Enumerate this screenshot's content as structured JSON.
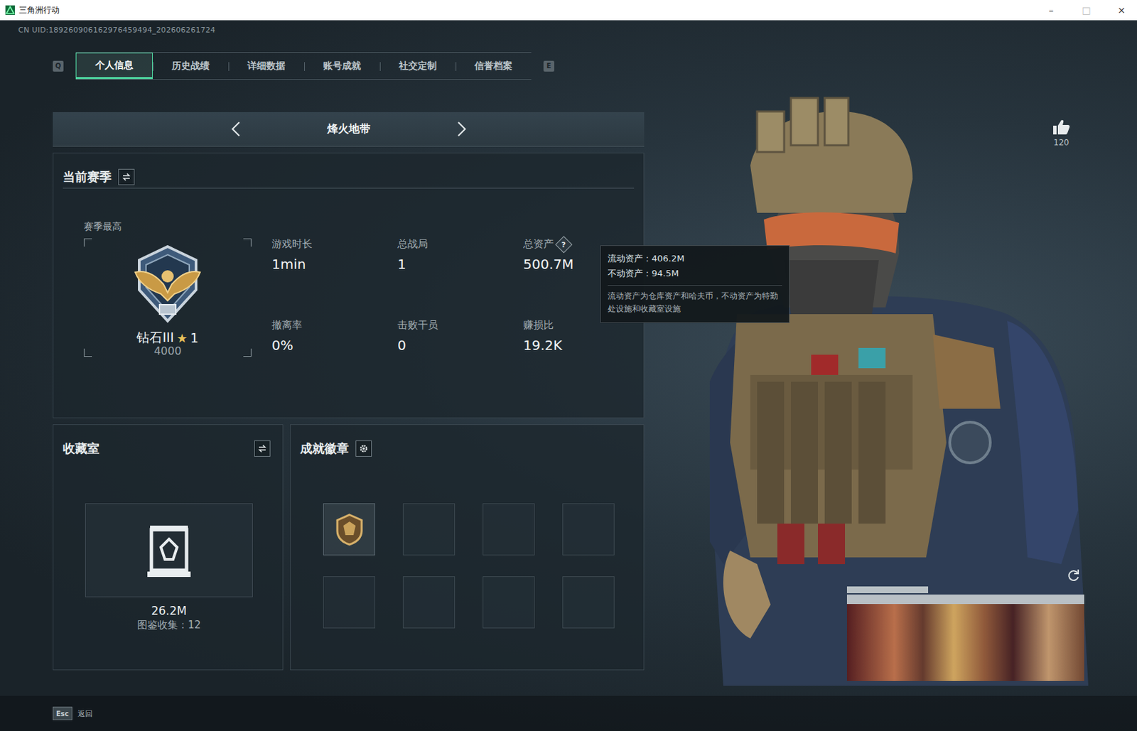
{
  "window": {
    "title": "三角洲行动",
    "controls": [
      "–",
      "□",
      "×"
    ]
  },
  "uid": "CN UID:189260906162976459494_202606261724",
  "tabs": {
    "prev_key": "Q",
    "next_key": "E",
    "items": [
      {
        "label": "个人信息",
        "selected": true
      },
      {
        "label": "历史战绩",
        "selected": false
      },
      {
        "label": "详细数据",
        "selected": false
      },
      {
        "label": "账号成就",
        "selected": false
      },
      {
        "label": "社交定制",
        "selected": false
      },
      {
        "label": "信誉档案",
        "selected": false
      }
    ]
  },
  "mode": {
    "label": "烽火地带"
  },
  "season": {
    "title": "当前赛季",
    "best_label": "赛季最高",
    "rank": "钻石III",
    "star": "★",
    "stars": "1",
    "score": "4000",
    "stats": [
      {
        "label": "游戏时长",
        "value": "1min"
      },
      {
        "label": "总战局",
        "value": "1"
      },
      {
        "label": "总资产",
        "value": "500.7M",
        "help": "?"
      },
      {
        "label": "撤离率",
        "value": "0%"
      },
      {
        "label": "击败干员",
        "value": "0"
      },
      {
        "label": "赚损比",
        "value": "19.2K"
      }
    ]
  },
  "tooltip": {
    "lines": [
      "流动资产：406.2M",
      "不动资产：94.5M"
    ],
    "note": "流动资产为仓库资产和哈夫币，不动资产为特勤处设施和收藏室设施"
  },
  "collection": {
    "title": "收藏室",
    "value": "26.2M",
    "count": "图鉴收集：12"
  },
  "achievements": {
    "title": "成就徽章",
    "slots": [
      {
        "filled": true
      },
      {
        "filled": false
      },
      {
        "filled": false
      },
      {
        "filled": false
      },
      {
        "filled": false
      },
      {
        "filled": false
      },
      {
        "filled": false
      },
      {
        "filled": false
      }
    ]
  },
  "likes": {
    "count": "120"
  },
  "footer": {
    "key": "Esc",
    "label": "返回"
  }
}
